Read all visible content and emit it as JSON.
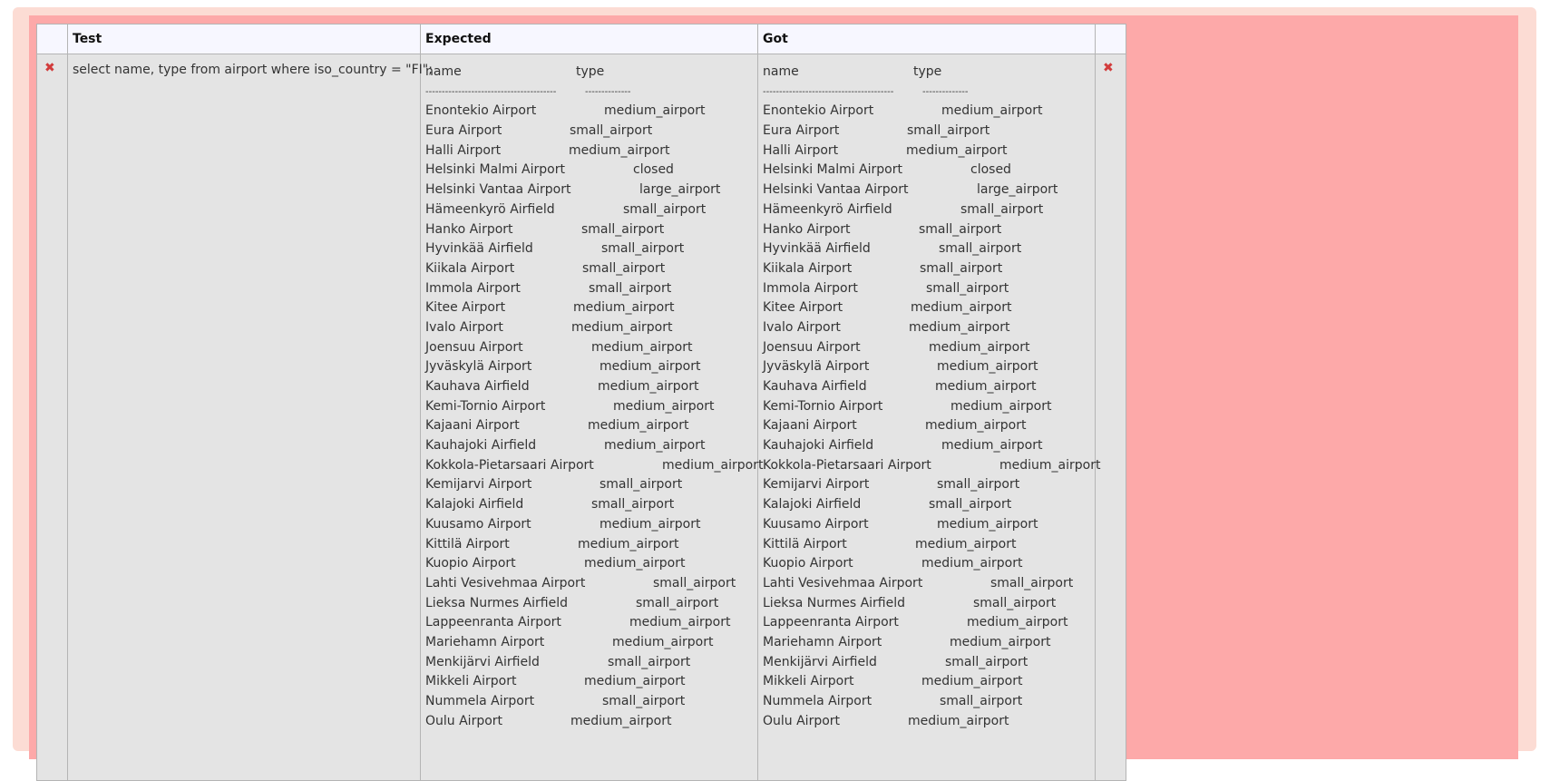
{
  "columns": {
    "test": "Test",
    "expected": "Expected",
    "got": "Got"
  },
  "status_icon": "close-icon",
  "colors": {
    "fail_border": "#fcdcd4",
    "fail_background": "#fda9a9",
    "fail_icon": "#d23c3c",
    "cell_background": "#e4e4e4",
    "header_background": "#f7f7ff"
  },
  "test": "select name, type from airport where iso_country = \"FI\";",
  "header_row": {
    "name": "name",
    "type": "type"
  },
  "separator": {
    "name": "----------------------------------------",
    "type": "--------------"
  },
  "rows": [
    {
      "name": "Enontekio Airport",
      "type": "medium_airport"
    },
    {
      "name": "Eura Airport",
      "type": "small_airport"
    },
    {
      "name": "Halli Airport",
      "type": "medium_airport"
    },
    {
      "name": "Helsinki Malmi Airport",
      "type": "closed"
    },
    {
      "name": "Helsinki Vantaa Airport",
      "type": "large_airport"
    },
    {
      "name": "Hämeenkyrö Airfield",
      "type": "small_airport"
    },
    {
      "name": "Hanko Airport",
      "type": "small_airport"
    },
    {
      "name": "Hyvinkää Airfield",
      "type": "small_airport"
    },
    {
      "name": "Kiikala Airport",
      "type": "small_airport"
    },
    {
      "name": "Immola Airport",
      "type": "small_airport"
    },
    {
      "name": "Kitee Airport",
      "type": "medium_airport"
    },
    {
      "name": "Ivalo Airport",
      "type": "medium_airport"
    },
    {
      "name": "Joensuu Airport",
      "type": "medium_airport"
    },
    {
      "name": "Jyväskylä Airport",
      "type": "medium_airport"
    },
    {
      "name": "Kauhava Airfield",
      "type": "medium_airport"
    },
    {
      "name": "Kemi-Tornio Airport",
      "type": "medium_airport"
    },
    {
      "name": "Kajaani Airport",
      "type": "medium_airport"
    },
    {
      "name": "Kauhajoki Airfield",
      "type": "medium_airport"
    },
    {
      "name": "Kokkola-Pietarsaari Airport",
      "type": "medium_airport"
    },
    {
      "name": "Kemijarvi Airport",
      "type": "small_airport"
    },
    {
      "name": "Kalajoki Airfield",
      "type": "small_airport"
    },
    {
      "name": "Kuusamo Airport",
      "type": "medium_airport"
    },
    {
      "name": "Kittilä Airport",
      "type": "medium_airport"
    },
    {
      "name": "Kuopio Airport",
      "type": "medium_airport"
    },
    {
      "name": "Lahti Vesivehmaa Airport",
      "type": "small_airport"
    },
    {
      "name": "Lieksa Nurmes Airfield",
      "type": "small_airport"
    },
    {
      "name": "Lappeenranta Airport",
      "type": "medium_airport"
    },
    {
      "name": "Mariehamn Airport",
      "type": "medium_airport"
    },
    {
      "name": "Menkijärvi Airfield",
      "type": "small_airport"
    },
    {
      "name": "Mikkeli Airport",
      "type": "medium_airport"
    },
    {
      "name": "Nummela Airport",
      "type": "small_airport"
    },
    {
      "name": "Oulu Airport",
      "type": "medium_airport"
    }
  ]
}
